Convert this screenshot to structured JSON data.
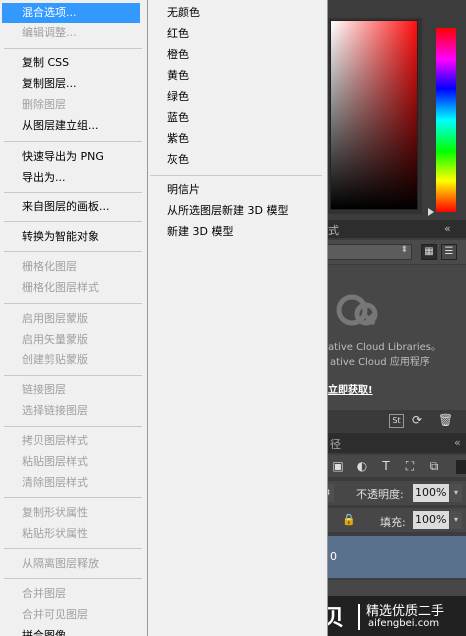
{
  "context_menu": {
    "items": [
      {
        "label": "混合选项...",
        "state": "highlighted"
      },
      {
        "label": "编辑调整...",
        "state": "disabled"
      },
      {
        "label": "复制 CSS",
        "state": "enabled"
      },
      {
        "label": "复制图层...",
        "state": "enabled"
      },
      {
        "label": "删除图层",
        "state": "disabled"
      },
      {
        "label": "从图层建立组...",
        "state": "enabled"
      },
      {
        "label": "快速导出为 PNG",
        "state": "enabled"
      },
      {
        "label": "导出为...",
        "state": "enabled"
      },
      {
        "label": "来自图层的画板...",
        "state": "enabled"
      },
      {
        "label": "转换为智能对象",
        "state": "enabled"
      },
      {
        "label": "栅格化图层",
        "state": "disabled"
      },
      {
        "label": "栅格化图层样式",
        "state": "disabled"
      },
      {
        "label": "启用图层蒙版",
        "state": "disabled"
      },
      {
        "label": "启用矢量蒙版",
        "state": "disabled"
      },
      {
        "label": "创建剪贴蒙版",
        "state": "disabled"
      },
      {
        "label": "链接图层",
        "state": "disabled"
      },
      {
        "label": "选择链接图层",
        "state": "disabled"
      },
      {
        "label": "拷贝图层样式",
        "state": "disabled"
      },
      {
        "label": "粘贴图层样式",
        "state": "disabled"
      },
      {
        "label": "清除图层样式",
        "state": "disabled"
      },
      {
        "label": "复制形状属性",
        "state": "disabled"
      },
      {
        "label": "粘贴形状属性",
        "state": "disabled"
      },
      {
        "label": "从隔离图层释放",
        "state": "disabled"
      },
      {
        "label": "合并图层",
        "state": "disabled"
      },
      {
        "label": "合并可见图层",
        "state": "disabled"
      },
      {
        "label": "拼合图像",
        "state": "enabled"
      }
    ]
  },
  "color_submenu": {
    "colors": [
      "无颜色",
      "红色",
      "橙色",
      "黄色",
      "绿色",
      "蓝色",
      "紫色",
      "灰色"
    ],
    "actions": [
      "明信片",
      "从所选图层新建 3D 模型",
      "新建 3D 模型"
    ]
  },
  "background_panels": {
    "tab_fragment": "式",
    "cc_line1": "ative Cloud Libraries。",
    "cc_line2": "ative Cloud 应用程序",
    "cc_link": "立即获取!",
    "layers_tab_fragment": "径",
    "opacity_label": "不透明度:",
    "opacity_value": "100%",
    "fill_label": "填充:",
    "fill_value": "100%",
    "layer_name_fragment": "0",
    "colors": {
      "menu_bg": "#f0f0f0",
      "highlight": "#3399ff",
      "disabled_text": "#a0a0a0",
      "panel_bg": "#474747",
      "selected_layer": "#59718c"
    }
  },
  "watermark": {
    "brand": "爱锋贝",
    "tagline": "精选优质二手",
    "url": "aifengbei.com"
  }
}
